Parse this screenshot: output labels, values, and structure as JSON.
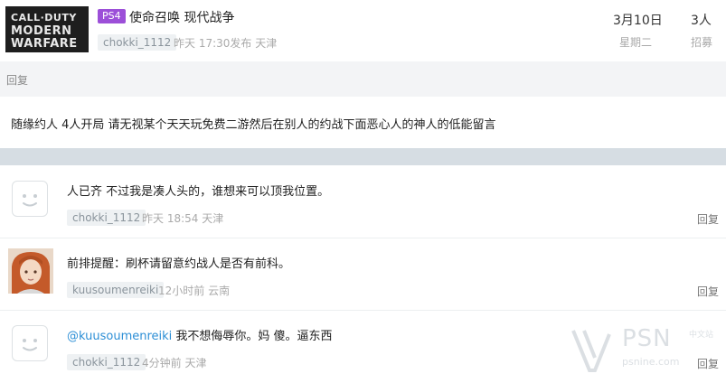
{
  "header": {
    "cover": {
      "line1": "CALL·DUTY",
      "line2": "MODERN",
      "line3": "WARFARE"
    },
    "platform": "PS4",
    "title": "使命召唤 现代战争",
    "author": "chokki_1112",
    "meta": "昨天 17:30发布 天津",
    "date": "3月10日",
    "weekday": "星期二",
    "count": "3人",
    "recruit": "招募"
  },
  "reply_label": "回复",
  "description": "随缘约人 4人开局 请无视某个天天玩免费二游然后在别人的约战下面恶心人的神人的低能留言",
  "comments": [
    {
      "mention": "",
      "text": "人已齐 不过我是凑人头的，谁想来可以顶我位置。",
      "author": "chokki_1112",
      "time": "昨天 18:54 天津",
      "reply": "回复"
    },
    {
      "mention": "",
      "text": "前排提醒：刷杯请留意约战人是否有前科。",
      "author": "kuusoumenreiki",
      "time": "12小时前 云南",
      "reply": "回复"
    },
    {
      "mention": "@kuusoumenreiki",
      "text": " 我不想侮辱你。妈 傻。逼东西",
      "author": "chokki_1112",
      "time": "4分钟前 天津",
      "reply": "回复"
    }
  ],
  "watermark": {
    "brand": "PSN",
    "cn": "中文站",
    "domain": "psnine.com"
  },
  "colors": {
    "platform_badge": "#9c4fd8",
    "mention": "#2d8fd6",
    "separator": "#d6dde3"
  }
}
